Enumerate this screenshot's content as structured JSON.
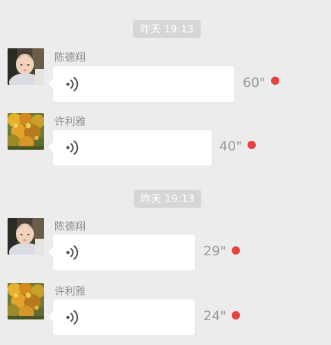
{
  "chat": {
    "colors": {
      "background": "#ececec",
      "bubble": "#ffffff",
      "time_badge": "#d6d6d6",
      "unread_dot": "#e64340",
      "duration_text": "#999999",
      "sender_text": "#8a8a8a"
    },
    "time_labels": [
      "昨天 19:13",
      "昨天 19:13"
    ],
    "messages": [
      {
        "sender": "陈德翔",
        "avatar": "baby-photo",
        "type": "voice",
        "icon": "voice-wave-icon",
        "duration": "60\"",
        "unread": true
      },
      {
        "sender": "许利雅",
        "avatar": "autumn-tree-photo",
        "type": "voice",
        "icon": "voice-wave-icon",
        "duration": "40\"",
        "unread": true
      },
      {
        "sender": "陈德翔",
        "avatar": "baby-photo",
        "type": "voice",
        "icon": "voice-wave-icon",
        "duration": "29\"",
        "unread": true
      },
      {
        "sender": "许利雅",
        "avatar": "autumn-tree-photo",
        "type": "voice",
        "icon": "voice-wave-icon",
        "duration": "24\"",
        "unread": true
      }
    ]
  }
}
